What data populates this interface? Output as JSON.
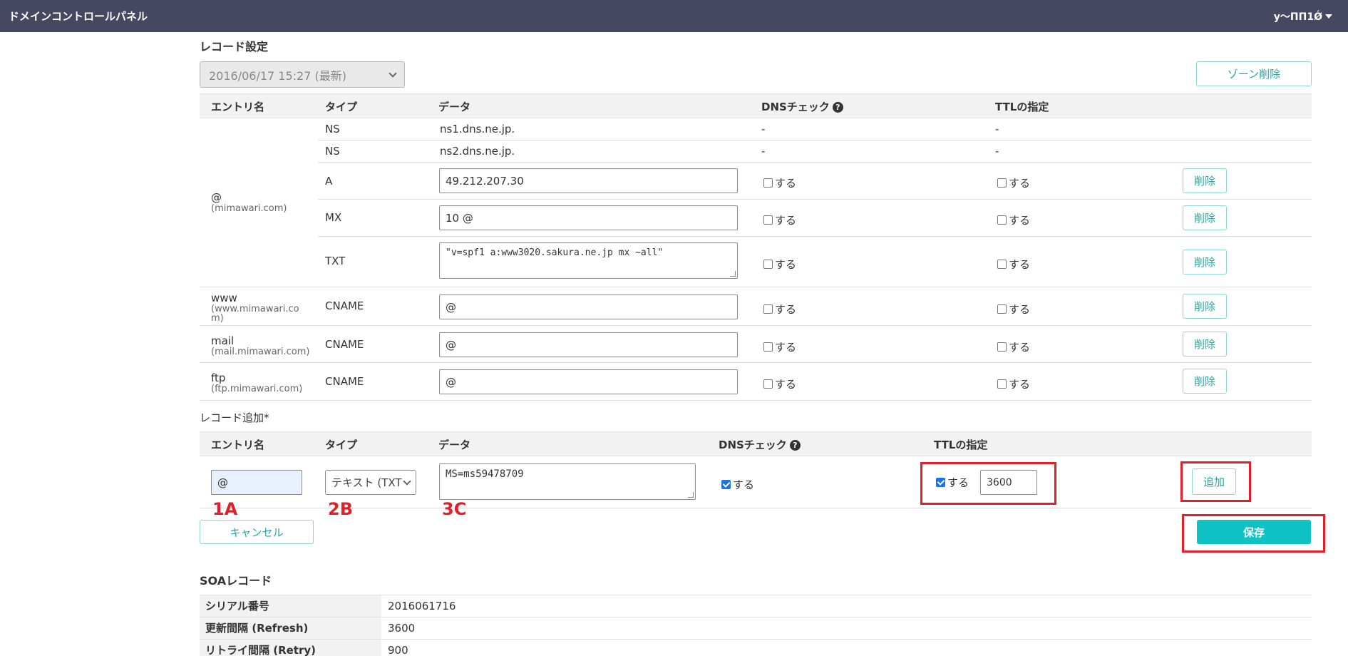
{
  "topbar": {
    "title": "ドメインコントロールパネル",
    "user": "y〜ΠΠ1Ǿ"
  },
  "records": {
    "section_title": "レコード設定",
    "version_select": "2016/06/17 15:27 (最新)",
    "delete_zone_label": "ゾーン削除",
    "headers": {
      "entry": "エントリ名",
      "type": "タイプ",
      "data": "データ",
      "dns": "DNSチェック",
      "ttl": "TTLの指定"
    },
    "help_glyph": "?",
    "check_label": "する",
    "delete_label": "削除",
    "rows": [
      {
        "type": "NS",
        "data": "ns1.dns.ne.jp.",
        "dns": "-",
        "ttl": "-"
      },
      {
        "type": "NS",
        "data": "ns2.dns.ne.jp.",
        "dns": "-",
        "ttl": "-"
      },
      {
        "type": "A",
        "data": "49.212.207.30"
      },
      {
        "type": "MX",
        "data": "10 @"
      },
      {
        "type": "TXT",
        "data": "\"v=spf1 a:www3020.sakura.ne.jp mx ~all\""
      },
      {
        "type": "CNAME",
        "data": "@"
      },
      {
        "type": "CNAME",
        "data": "@"
      },
      {
        "type": "CNAME",
        "data": "@"
      }
    ],
    "entries": [
      {
        "name": "@",
        "sub": "(mimawari.com)"
      },
      {
        "name": "www",
        "sub": "(www.mimawari.co",
        "sub2": "m)"
      },
      {
        "name": "mail",
        "sub": "(mail.mimawari.com)"
      },
      {
        "name": "ftp",
        "sub": "(ftp.mimawari.com)"
      }
    ]
  },
  "add_record": {
    "section_title": "レコード追加*",
    "entry_value": "@",
    "type_value": "テキスト (TXT",
    "data_value": "MS=ms59478709",
    "dns_checked": true,
    "ttl_checked": true,
    "ttl_value": "3600",
    "add_label": "追加",
    "cancel_label": "キャンセル",
    "save_label": "保存",
    "annotations": [
      "1A",
      "2B",
      "3C"
    ]
  },
  "soa": {
    "section_title": "SOAレコード",
    "rows": [
      {
        "label": "シリアル番号",
        "value": "2016061716"
      },
      {
        "label": "更新間隔 (Refresh)",
        "value": "3600"
      },
      {
        "label": "リトライ間隔 (Retry)",
        "value": "900"
      }
    ]
  }
}
